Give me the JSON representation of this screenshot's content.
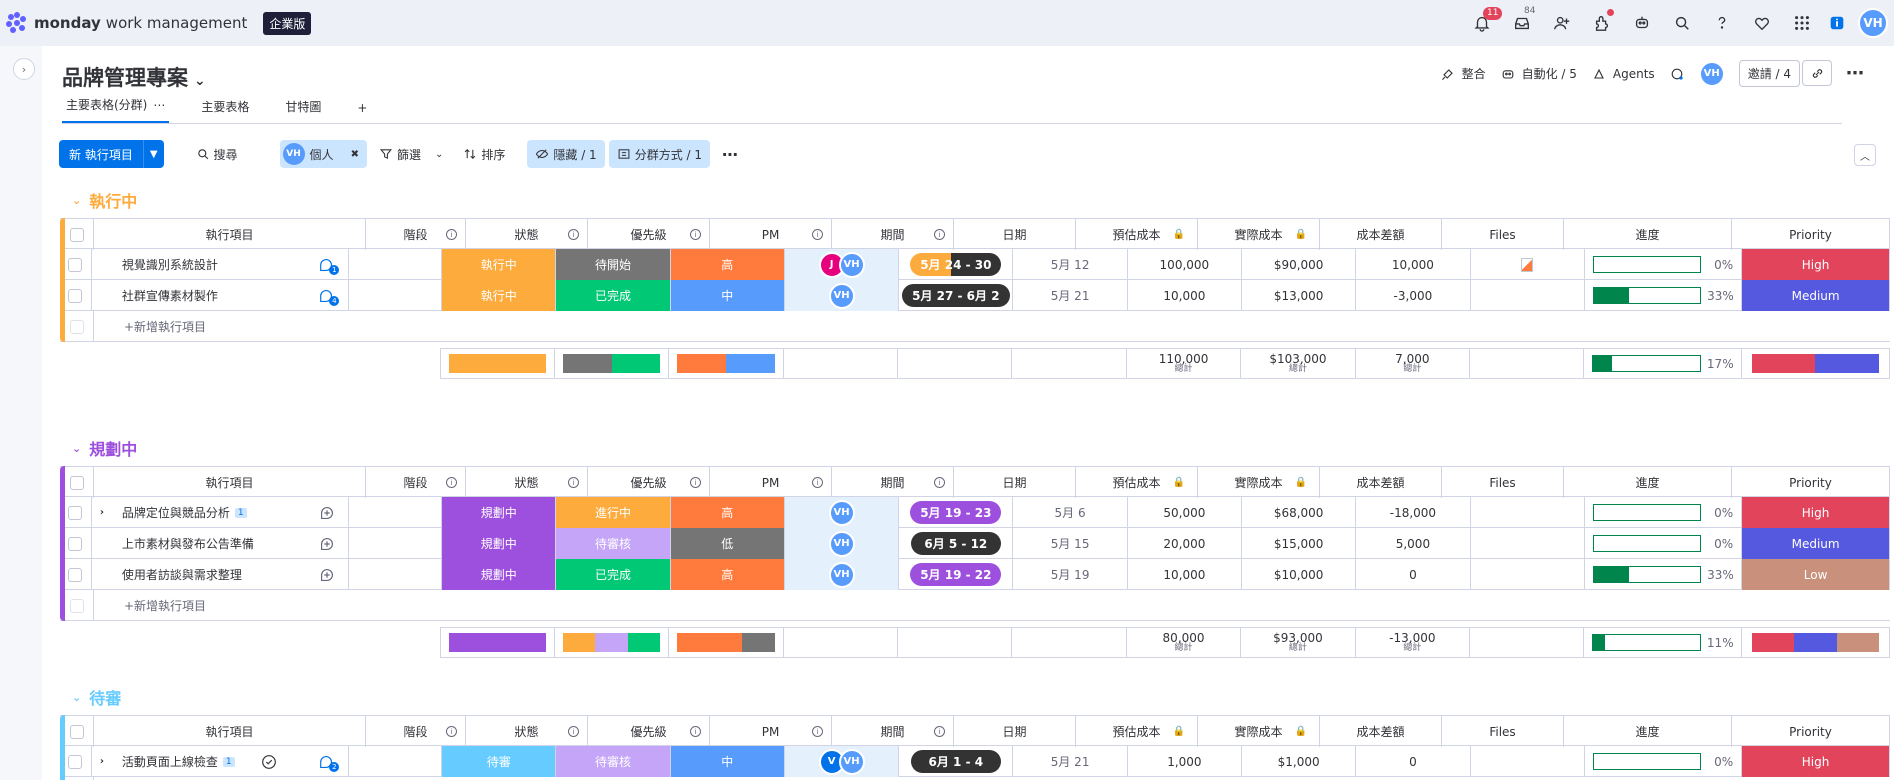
{
  "topbar": {
    "brand": "monday",
    "brand_sub": "work management",
    "edition": "企業版",
    "notif_count": "11",
    "inbox_count": "84",
    "user_initials": "VH"
  },
  "board": {
    "title": "品牌管理專案",
    "actions": {
      "integrate": "整合",
      "automate": "自動化 / 5",
      "agents": "Agents",
      "invite": "邀請 / 4"
    }
  },
  "tabs": [
    "主要表格(分群)",
    "主要表格",
    "甘特圖"
  ],
  "toolbar": {
    "new_item": "新 執行項目",
    "search": "搜尋",
    "person": "個人",
    "filter": "篩選",
    "sort": "排序",
    "hide": "隱藏 / 1",
    "group_by": "分群方式 / 1"
  },
  "columns": [
    "執行項目",
    "階段",
    "狀態",
    "優先級",
    "PM",
    "期間",
    "日期",
    "預估成本",
    "實際成本",
    "成本差額",
    "Files",
    "進度",
    "Priority"
  ],
  "add_item": "+新增執行項目",
  "sum_label": "總計",
  "colors": {
    "orange": "#fdab3d",
    "purple": "#9d50dd",
    "lightblue": "#66ccff",
    "green": "#00c875",
    "gray": "#757575",
    "darkorange": "#ff7b3d",
    "blue": "#579bfc",
    "lavender": "#c4a5f7",
    "high": "#e2445c",
    "medium": "#5559df",
    "low": "#c9907c",
    "dark": "#333333"
  },
  "groups": [
    {
      "title": "執行中",
      "color": "#fdab3d",
      "rows": [
        {
          "name": "視覺識別系統設計",
          "stage": "執行中",
          "status": "待開始",
          "priority": "高",
          "pm": [
            "J",
            "VH"
          ],
          "period": "5月 24 - 30",
          "period_style": "split",
          "date": "5月 12",
          "est": "100,000",
          "act": "$90,000",
          "diff": "10,000",
          "file": true,
          "progress": 0,
          "progress_text": "0%",
          "prio": "High",
          "comments": "1",
          "status_color": "#757575",
          "priority_color": "#ff7b3d",
          "prio_color": "#e2445c"
        },
        {
          "name": "社群宣傳素材製作",
          "stage": "執行中",
          "status": "已完成",
          "priority": "中",
          "pm": [
            "VH"
          ],
          "period": "5月 27 - 6月 2",
          "period_style": "dark",
          "date": "5月 21",
          "est": "10,000",
          "act": "$13,000",
          "diff": "-3,000",
          "file": false,
          "progress": 33,
          "progress_text": "33%",
          "prio": "Medium",
          "comments": "4",
          "status_color": "#00c875",
          "priority_color": "#579bfc",
          "prio_color": "#5559df"
        }
      ],
      "sum": {
        "est": "110,000",
        "act": "$103,000",
        "diff": "7,000",
        "progress": 17,
        "progress_text": "17%"
      }
    },
    {
      "title": "規劃中",
      "color": "#9d50dd",
      "rows": [
        {
          "name": "品牌定位與競品分析",
          "sub": "1",
          "stage": "規劃中",
          "status": "進行中",
          "priority": "高",
          "pm": [
            "VH"
          ],
          "period": "5月 19 - 23",
          "period_style": "purple",
          "date": "5月 6",
          "est": "50,000",
          "act": "$68,000",
          "diff": "-18,000",
          "file": false,
          "progress": 0,
          "progress_text": "0%",
          "prio": "High",
          "status_color": "#fdab3d",
          "priority_color": "#ff7b3d",
          "prio_color": "#e2445c"
        },
        {
          "name": "上市素材與發布公告準備",
          "stage": "規劃中",
          "status": "待審核",
          "priority": "低",
          "pm": [
            "VH"
          ],
          "period": "6月 5 - 12",
          "period_style": "dark",
          "date": "5月 15",
          "est": "20,000",
          "act": "$15,000",
          "diff": "5,000",
          "file": false,
          "progress": 0,
          "progress_text": "0%",
          "prio": "Medium",
          "status_color": "#c4a5f7",
          "priority_color": "#757575",
          "prio_color": "#5559df"
        },
        {
          "name": "使用者訪談與需求整理",
          "stage": "規劃中",
          "status": "已完成",
          "priority": "高",
          "pm": [
            "VH"
          ],
          "period": "5月 19 - 22",
          "period_style": "purple",
          "date": "5月 19",
          "est": "10,000",
          "act": "$10,000",
          "diff": "0",
          "file": false,
          "progress": 33,
          "progress_text": "33%",
          "prio": "Low",
          "status_color": "#00c875",
          "priority_color": "#ff7b3d",
          "prio_color": "#c9907c"
        }
      ],
      "sum": {
        "est": "80,000",
        "act": "$93,000",
        "diff": "-13,000",
        "progress": 11,
        "progress_text": "11%"
      }
    },
    {
      "title": "待審",
      "color": "#66ccff",
      "rows": [
        {
          "name": "活動頁面上線檢查",
          "sub": "1",
          "stage": "待審",
          "status": "待審核",
          "priority": "中",
          "pm": [
            "V",
            "VH"
          ],
          "period": "6月 1 - 4",
          "period_style": "dark",
          "date": "5月 21",
          "est": "1,000",
          "act": "$1,000",
          "diff": "0",
          "file": false,
          "progress": 0,
          "progress_text": "0%",
          "prio": "High",
          "comments": "2",
          "status_color": "#c4a5f7",
          "priority_color": "#579bfc",
          "prio_color": "#e2445c"
        }
      ]
    }
  ]
}
